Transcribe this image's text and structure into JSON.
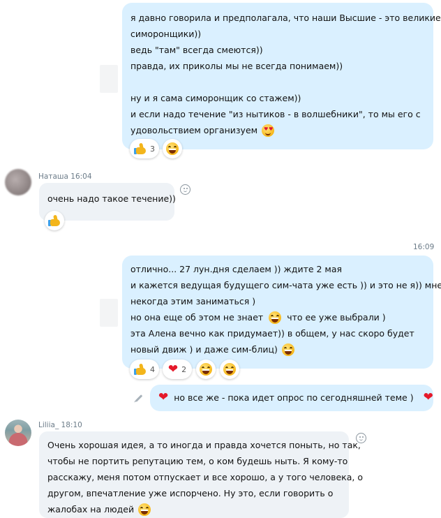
{
  "messages": {
    "m1": {
      "lines": [
        "я давно говорила и предполагала, что наши Высшие - это великие",
        "симоронщики))",
        "ведь \"там\" всегда смеются))",
        "правда, их приколы мы не всегда понимаем))",
        "",
        "ну и я сама симоронщик со стажем))",
        "и если надо течение \"из нытиков - в волшебники\", то мы его с",
        "удовольствием организуем"
      ],
      "reactions": [
        {
          "icon": "thumbs-up-icon",
          "count": "3"
        },
        {
          "icon": "laughing-face-icon",
          "count": ""
        }
      ]
    },
    "m2": {
      "sender": "Наташа",
      "time": "16:04",
      "text": "очень надо такое течение))",
      "reactions": [
        {
          "icon": "thumbs-up-icon",
          "count": ""
        }
      ]
    },
    "m3": {
      "time": "16:09",
      "lines": [
        "отлично... 27 лун.дня сделаем )) ждите 2 мая",
        "и кажется ведущая будущего сим-чата уже есть )) и это не я)) мне",
        "некогда этим заниматься )",
        "но она еще об этом не знает",
        "что ее уже выбрали )",
        "эта Алена вечно как придумает)) в общем, у нас скоро будет",
        "новый движ ) и даже сим-блиц)"
      ],
      "reactions": [
        {
          "icon": "thumbs-up-icon",
          "count": "4"
        },
        {
          "icon": "heart-icon",
          "count": "2"
        },
        {
          "icon": "winking-laughing-face-icon",
          "count": ""
        },
        {
          "icon": "laughing-face-icon",
          "count": ""
        }
      ]
    },
    "m4": {
      "text": "но все же - пока идет опрос по сегодняшней теме )"
    },
    "m5": {
      "sender": "Liliia_",
      "time": "18:10",
      "lines": [
        "Очень хорошая идея, а то иногда и правда хочется поныть, но так,",
        "чтобы не портить репутацию тем, о ком будешь ныть. Я  кому-то",
        "расскажу, меня потом отпускает и все хорошо, а у того человека, о",
        "другом,  впечатление уже испорчено. Ну это, если говорить о",
        "жалобах на людей"
      ]
    }
  },
  "colors": {
    "outgoing_bubble": "#daf0ff",
    "incoming_bubble": "#eef2f6",
    "meta_text": "#6b7b88",
    "heart": "#e5192a"
  }
}
